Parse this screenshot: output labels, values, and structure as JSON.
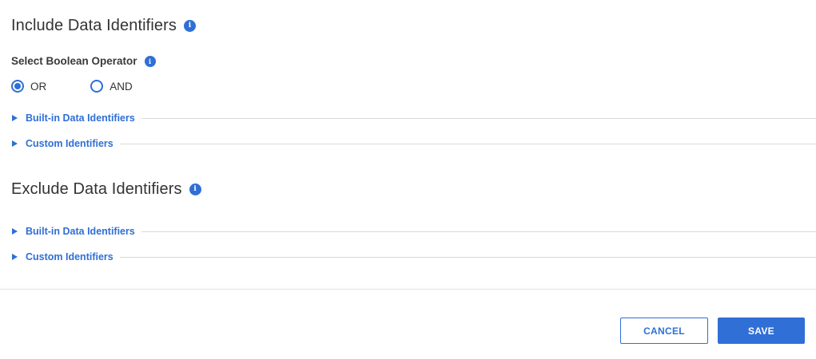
{
  "include": {
    "title": "Include Data Identifiers",
    "operator_label": "Select Boolean Operator",
    "options": [
      {
        "label": "OR",
        "selected": true
      },
      {
        "label": "AND",
        "selected": false
      }
    ],
    "builtin_label": "Built-in Data Identifiers",
    "custom_label": "Custom Identifiers"
  },
  "exclude": {
    "title": "Exclude Data Identifiers",
    "builtin_label": "Built-in Data Identifiers",
    "custom_label": "Custom Identifiers"
  },
  "footer": {
    "cancel_label": "CANCEL",
    "save_label": "SAVE"
  },
  "colors": {
    "accent": "#2f6fd6",
    "divider": "#d9d9d9"
  },
  "icons": {
    "info": "info-icon",
    "expand": "triangle-right-icon"
  }
}
